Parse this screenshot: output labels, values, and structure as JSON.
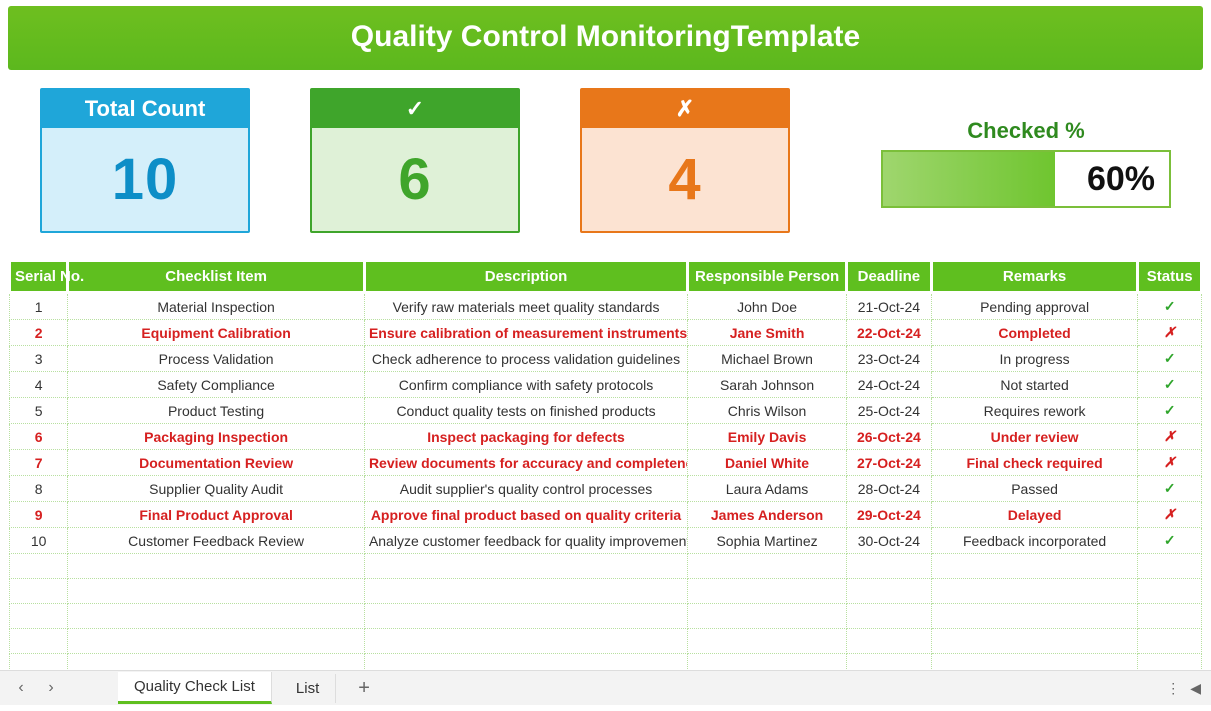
{
  "title": "Quality Control MonitoringTemplate",
  "cards": {
    "total": {
      "label": "Total Count",
      "value": "10"
    },
    "check": {
      "label": "✓",
      "value": "6"
    },
    "cross": {
      "label": "✗",
      "value": "4"
    }
  },
  "checked": {
    "label": "Checked %",
    "percent_text": "60%",
    "percent_width": "60%"
  },
  "headers": {
    "serial": "Serial No.",
    "item": "Checklist Item",
    "desc": "Description",
    "person": "Responsible Person",
    "deadline": "Deadline",
    "remarks": "Remarks",
    "status": "Status"
  },
  "rows": [
    {
      "serial": "1",
      "item": "Material Inspection",
      "desc": "Verify raw materials meet quality standards",
      "person": "John Doe",
      "deadline": "21-Oct-24",
      "remarks": "Pending approval",
      "status": "✓",
      "ok": true
    },
    {
      "serial": "2",
      "item": "Equipment Calibration",
      "desc": "Ensure calibration of measurement instruments",
      "person": "Jane Smith",
      "deadline": "22-Oct-24",
      "remarks": "Completed",
      "status": "✗",
      "ok": false
    },
    {
      "serial": "3",
      "item": "Process Validation",
      "desc": "Check adherence to process validation guidelines",
      "person": "Michael Brown",
      "deadline": "23-Oct-24",
      "remarks": "In progress",
      "status": "✓",
      "ok": true
    },
    {
      "serial": "4",
      "item": "Safety Compliance",
      "desc": "Confirm compliance with safety protocols",
      "person": "Sarah Johnson",
      "deadline": "24-Oct-24",
      "remarks": "Not started",
      "status": "✓",
      "ok": true
    },
    {
      "serial": "5",
      "item": "Product Testing",
      "desc": "Conduct quality tests on finished products",
      "person": "Chris Wilson",
      "deadline": "25-Oct-24",
      "remarks": "Requires rework",
      "status": "✓",
      "ok": true
    },
    {
      "serial": "6",
      "item": "Packaging Inspection",
      "desc": "Inspect packaging for defects",
      "person": "Emily Davis",
      "deadline": "26-Oct-24",
      "remarks": "Under review",
      "status": "✗",
      "ok": false
    },
    {
      "serial": "7",
      "item": "Documentation Review",
      "desc": "Review documents for accuracy and completeness",
      "person": "Daniel White",
      "deadline": "27-Oct-24",
      "remarks": "Final check required",
      "status": "✗",
      "ok": false
    },
    {
      "serial": "8",
      "item": "Supplier Quality Audit",
      "desc": "Audit supplier's quality control processes",
      "person": "Laura Adams",
      "deadline": "28-Oct-24",
      "remarks": "Passed",
      "status": "✓",
      "ok": true
    },
    {
      "serial": "9",
      "item": "Final Product Approval",
      "desc": "Approve final product based on quality criteria",
      "person": "James Anderson",
      "deadline": "29-Oct-24",
      "remarks": "Delayed",
      "status": "✗",
      "ok": false
    },
    {
      "serial": "10",
      "item": "Customer Feedback Review",
      "desc": "Analyze customer feedback for quality improvement",
      "person": "Sophia Martinez",
      "deadline": "30-Oct-24",
      "remarks": "Feedback incorporated",
      "status": "✓",
      "ok": true
    }
  ],
  "empty_rows": 5,
  "tabs": {
    "active": "Quality Check List",
    "other": "List",
    "add": "+"
  }
}
